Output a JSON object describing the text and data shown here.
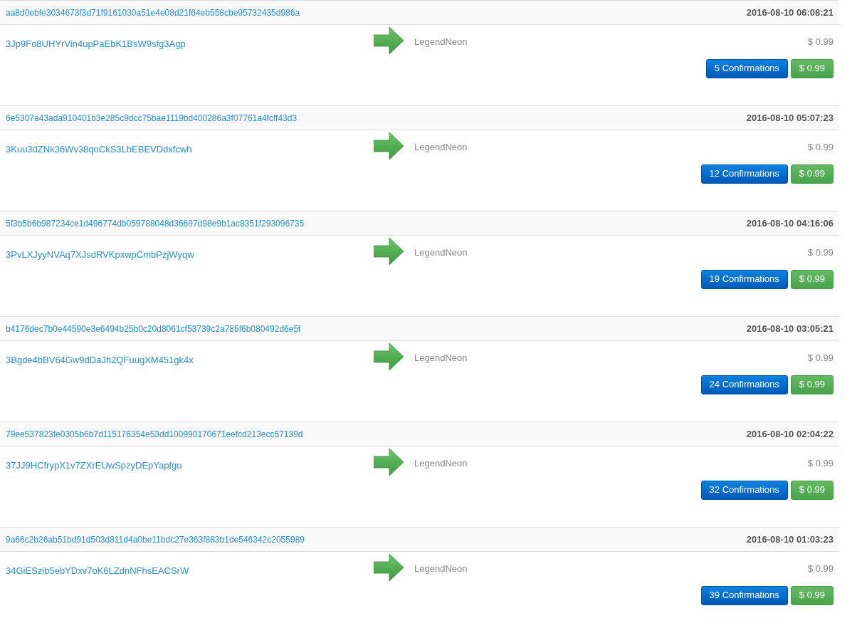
{
  "transactions": [
    {
      "hash": "aa8d0ebfe3034673f3d71f9161030a51e4e08d21f64eb558cbe95732435d986a",
      "time": "2016-08-10 06:08:21",
      "from": "3Jp9Fo8UHYrVin4upPaEbK1BsW9sfg3Agp",
      "to": "LegendNeon",
      "amount": "$ 0.99",
      "confirmations": "5 Confirmations",
      "total": "$ 0.99"
    },
    {
      "hash": "6e5307a43ada910401b3e285c9dcc75bae1119bd400286a3f07761a4fcff43d3",
      "time": "2016-08-10 05:07:23",
      "from": "3Kuu3dZNk36Wv38qoCkS3LbEBEVDdxfcwh",
      "to": "LegendNeon",
      "amount": "$ 0.99",
      "confirmations": "12 Confirmations",
      "total": "$ 0.99"
    },
    {
      "hash": "5f3b5b6b987234ce1d496774db059788048d36697d98e9b1ac8351f293096735",
      "time": "2016-08-10 04:16:06",
      "from": "3PvLXJyyNVAq7XJsdRVKpxwpCmbPzjWyqw",
      "to": "LegendNeon",
      "amount": "$ 0.99",
      "confirmations": "19 Confirmations",
      "total": "$ 0.99"
    },
    {
      "hash": "b4176dec7b0e44590e3e6494b25b0c20d8061cf53739c2a785f6b080492d6e5f",
      "time": "2016-08-10 03:05:21",
      "from": "3Bgde4bBV64Gw9dDaJh2QFuugXM451gk4x",
      "to": "LegendNeon",
      "amount": "$ 0.99",
      "confirmations": "24 Confirmations",
      "total": "$ 0.99"
    },
    {
      "hash": "79ee537823fe0305b6b7d115176354e53dd100990170671eefcd213ecc57139d",
      "time": "2016-08-10 02:04:22",
      "from": "37JJ9HCfrypX1v7ZXrEUwSpzyDEpYapfgu",
      "to": "LegendNeon",
      "amount": "$ 0.99",
      "confirmations": "32 Confirmations",
      "total": "$ 0.99"
    },
    {
      "hash": "9a66c2b26ab51bd91d503d811d4a0be11bdc27e363f883b1de546342c2055989",
      "time": "2016-08-10 01:03:23",
      "from": "34GiESzib5ebYDxv7oK6LZdnNFhsEACSrW",
      "to": "LegendNeon",
      "amount": "$ 0.99",
      "confirmations": "39 Confirmations",
      "total": "$ 0.99"
    }
  ]
}
